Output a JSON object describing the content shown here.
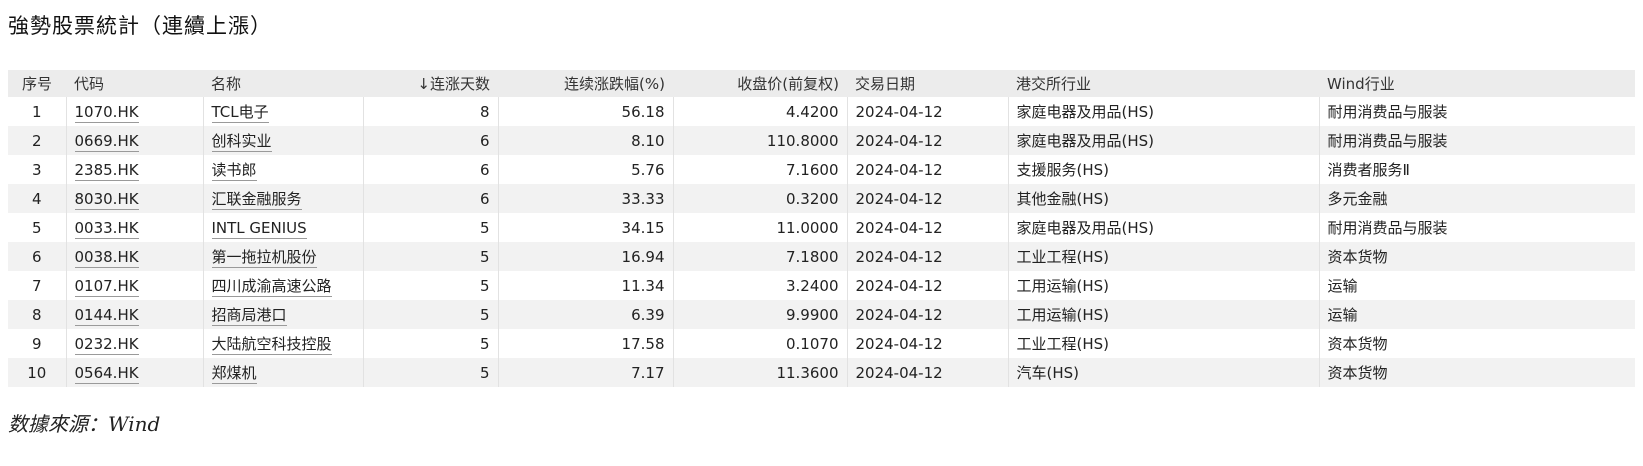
{
  "title": "強勢股票統計（連續上漲）",
  "table": {
    "headers": [
      "序号",
      "代码",
      "名称",
      "↓连涨天数",
      "连续涨跌幅(%)",
      "收盘价(前复权)",
      "交易日期",
      "港交所行业",
      "Wind行业"
    ],
    "rows": [
      [
        "1",
        "1070.HK",
        "TCL电子",
        "8",
        "56.18",
        "4.4200",
        "2024-04-12",
        "家庭电器及用品(HS)",
        "耐用消费品与服装"
      ],
      [
        "2",
        "0669.HK",
        "创科实业",
        "6",
        "8.10",
        "110.8000",
        "2024-04-12",
        "家庭电器及用品(HS)",
        "耐用消费品与服装"
      ],
      [
        "3",
        "2385.HK",
        "读书郎",
        "6",
        "5.76",
        "7.1600",
        "2024-04-12",
        "支援服务(HS)",
        "消费者服务Ⅱ"
      ],
      [
        "4",
        "8030.HK",
        "汇联金融服务",
        "6",
        "33.33",
        "0.3200",
        "2024-04-12",
        "其他金融(HS)",
        "多元金融"
      ],
      [
        "5",
        "0033.HK",
        "INTL GENIUS",
        "5",
        "34.15",
        "11.0000",
        "2024-04-12",
        "家庭电器及用品(HS)",
        "耐用消费品与服装"
      ],
      [
        "6",
        "0038.HK",
        "第一拖拉机股份",
        "5",
        "16.94",
        "7.1800",
        "2024-04-12",
        "工业工程(HS)",
        "资本货物"
      ],
      [
        "7",
        "0107.HK",
        "四川成渝高速公路",
        "5",
        "11.34",
        "3.2400",
        "2024-04-12",
        "工用运输(HS)",
        "运输"
      ],
      [
        "8",
        "0144.HK",
        "招商局港口",
        "5",
        "6.39",
        "9.9900",
        "2024-04-12",
        "工用运输(HS)",
        "运输"
      ],
      [
        "9",
        "0232.HK",
        "大陆航空科技控股",
        "5",
        "17.58",
        "0.1070",
        "2024-04-12",
        "工业工程(HS)",
        "资本货物"
      ],
      [
        "10",
        "0564.HK",
        "郑煤机",
        "5",
        "7.17",
        "11.3600",
        "2024-04-12",
        "汽车(HS)",
        "资本货物"
      ]
    ]
  },
  "source": "数據來源：Wind"
}
